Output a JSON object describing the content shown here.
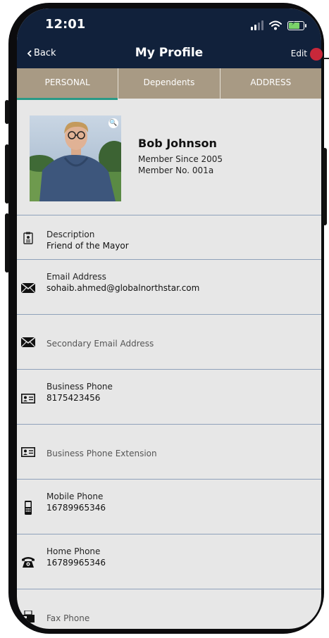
{
  "status_bar": {
    "time": "12:01"
  },
  "nav": {
    "back_label": "Back",
    "title": "My Profile",
    "edit_label": "Edit"
  },
  "tabs": [
    {
      "label": "PERSONAL",
      "active": true
    },
    {
      "label": "Dependents",
      "active": false
    },
    {
      "label": "ADDRESS",
      "active": false
    }
  ],
  "profile": {
    "name": "Bob Johnson",
    "member_since": "Member Since 2005",
    "member_number": "Member No. 001a"
  },
  "fields": [
    {
      "icon": "id-card-icon",
      "label": "Description",
      "value": "Friend of the Mayor"
    },
    {
      "icon": "envelope-icon",
      "label": "Email Address",
      "value": "sohaib.ahmed@globalnorthstar.com"
    },
    {
      "icon": "envelope-icon",
      "label": "Secondary Email Address",
      "value": ""
    },
    {
      "icon": "contact-card-icon",
      "label": "Business Phone",
      "value": "8175423456"
    },
    {
      "icon": "contact-card-icon",
      "label": "Business Phone Extension",
      "value": ""
    },
    {
      "icon": "mobile-phone-icon",
      "label": "Mobile Phone",
      "value": "16789965346"
    },
    {
      "icon": "telephone-icon",
      "label": "Home Phone",
      "value": "16789965346"
    },
    {
      "icon": "fax-icon",
      "label": "Fax Phone",
      "value": ""
    }
  ],
  "colors": {
    "header_bg": "#11213b",
    "tab_bg": "#a89a84",
    "tab_active_indicator": "#2a9a87",
    "content_bg": "#e7e7e7",
    "divider": "#8fa1ba",
    "edit_marker": "#c8283a"
  }
}
